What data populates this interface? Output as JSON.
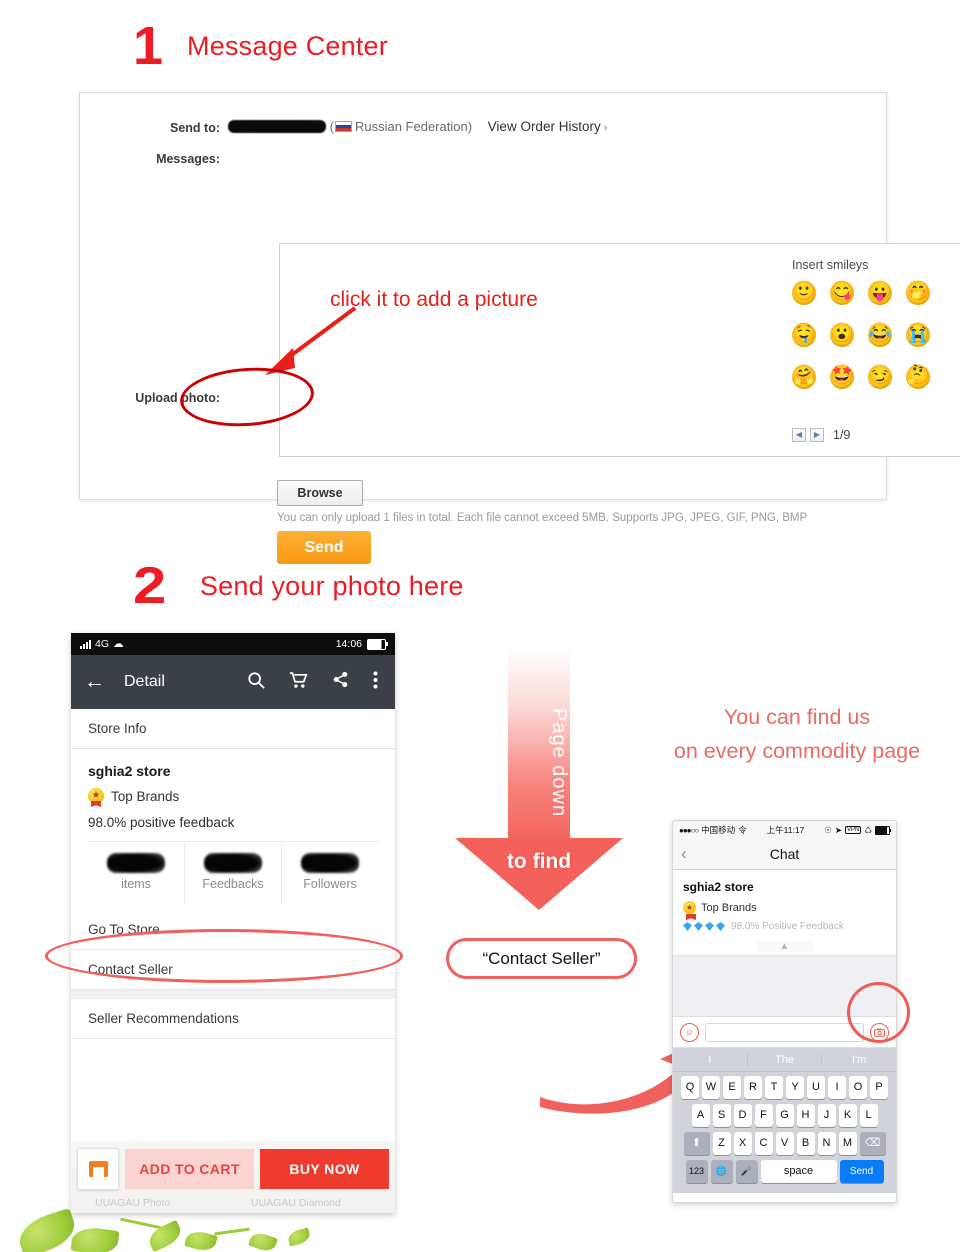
{
  "sections": [
    {
      "number": "1",
      "title": "Message Center"
    },
    {
      "number": "2",
      "title": "Send your photo here"
    }
  ],
  "message_center": {
    "send_to_label": "Send to:",
    "recipient_redacted": "",
    "country": "Russian Federation",
    "order_history_link": "View Order History",
    "order_history_chevron": "›",
    "messages_label": "Messages:",
    "message_value": "",
    "smileys": {
      "title": "Insert smileys",
      "glyphs": [
        "🙂",
        "😋",
        "😛",
        "🤭",
        "🤤",
        "😮",
        "😂",
        "😭",
        "🤗",
        "🤩",
        "😏",
        "🤔"
      ],
      "prev": "◀",
      "next": "▶",
      "page": "1/9"
    },
    "upload_label": "Upload photo:",
    "browse_label": "Browse",
    "upload_hint": "You can only upload 1 files in total. Each file cannot exceed 5MB. Supports JPG, JPEG, GIF, PNG, BMP",
    "send_label": "Send",
    "annotation_click": "click it to add a picture"
  },
  "android_phone": {
    "status": {
      "network": "4G",
      "time": "14:06"
    },
    "appbar": {
      "back": "←",
      "title": "Detail",
      "search_icon": "search-icon",
      "cart_icon": "cart-icon",
      "share_icon": "share-icon",
      "more_icon": "more-icon"
    },
    "store_info_header": "Store Info",
    "store_name": "sghia2 store",
    "top_brands": "Top Brands",
    "feedback": "98.0% positive feedback",
    "stats": [
      {
        "value": "",
        "label": "items"
      },
      {
        "value": "",
        "label": "Feedbacks"
      },
      {
        "value": "",
        "label": "Followers"
      }
    ],
    "rows": [
      "Go To Store",
      "Contact Seller",
      "Seller Recommendations"
    ],
    "add_to_cart": "ADD TO CART",
    "buy_now": "BUY NOW",
    "ghost_captions": [
      "UUAGAU Photo",
      "UUAGAU Diamond"
    ]
  },
  "page_down_arrow": {
    "shaft_text": "Page down",
    "head_text": "to find",
    "target_pill": "“Contact Seller”"
  },
  "right_text": {
    "line1": "You can find us",
    "line2": "on every commodity page"
  },
  "iphone": {
    "status": {
      "signal_dots": "●●●○○",
      "carrier": "中国移动",
      "wifi": "令",
      "time": "上午11:17",
      "vpn": "VPN"
    },
    "nav": {
      "back": "‹",
      "title": "Chat"
    },
    "store_name": "sghia2 store",
    "top_brands": "Top Brands",
    "positive_feedback": "98.0% Positive Feedback",
    "collapse_icon": "chevron-up-icon",
    "input_placeholder": "",
    "smiley_icon": "smiley-icon",
    "camera_icon": "camera-icon",
    "predictions": [
      "I",
      "The",
      "I'm"
    ],
    "keyboard": {
      "row1": [
        "Q",
        "W",
        "E",
        "R",
        "T",
        "Y",
        "U",
        "I",
        "O",
        "P"
      ],
      "row2": [
        "A",
        "S",
        "D",
        "F",
        "G",
        "H",
        "J",
        "K",
        "L"
      ],
      "row3": [
        "Z",
        "X",
        "C",
        "V",
        "B",
        "N",
        "M"
      ],
      "shift": "⬆",
      "backspace": "⌫",
      "numbers": "123",
      "globe": "🌐",
      "mic": "🎤",
      "space": "space",
      "send": "Send"
    }
  },
  "colors": {
    "red": "#ed1c24",
    "coral": "#f0605c",
    "orange": "#f79a14",
    "android_bar": "#3b3f46",
    "ios_blue": "#0a7cf7"
  }
}
